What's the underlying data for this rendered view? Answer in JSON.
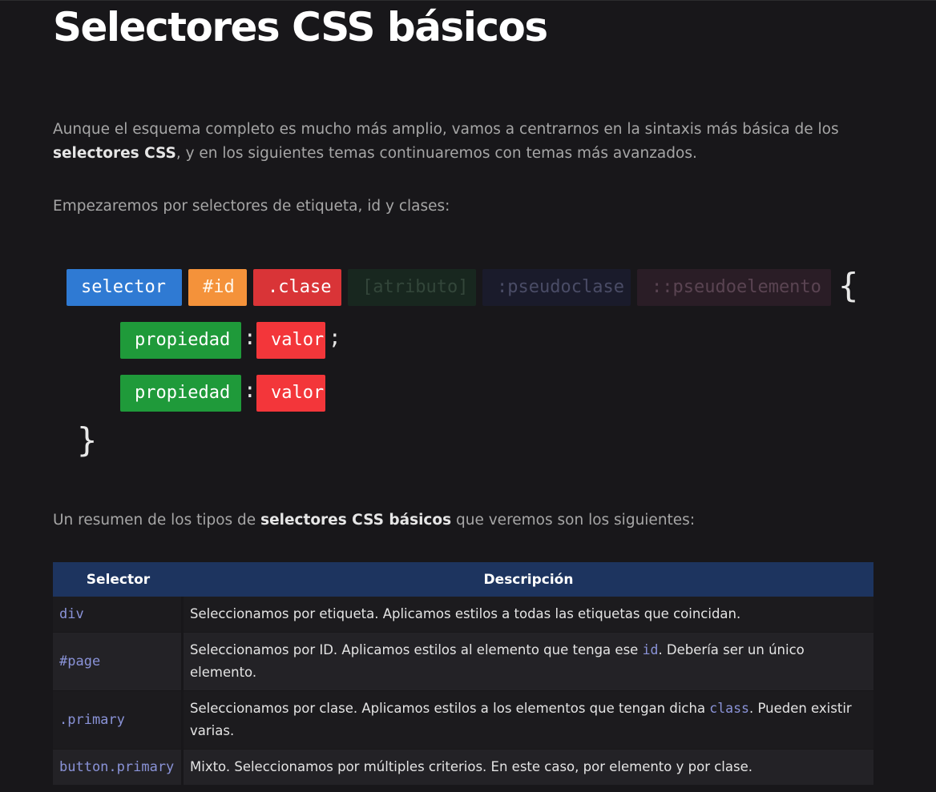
{
  "title": "Selectores CSS básicos",
  "intro": {
    "part1": "Aunque el esquema completo es mucho más amplio, vamos a centrarnos en la sintaxis más básica de los ",
    "bold": "selectores CSS",
    "part2": ", y en los siguientes temas continuaremos con temas más avanzados."
  },
  "lead": "Empezaremos por selectores de etiqueta, id y clases:",
  "diagram": {
    "selector": "selector",
    "id": "#id",
    "clase": ".clase",
    "atributo": "[atributo]",
    "pseudoclase": ":pseudoclase",
    "pseudoelemento": "::pseudoelemento",
    "open_brace": "{",
    "close_brace": "}",
    "colon": ":",
    "semicolon": ";",
    "property": "propiedad",
    "value": "valor",
    "colors": {
      "selector": "#2f7ad3",
      "id": "#f4923a",
      "clase": "#d93437",
      "property": "#1f9a3a",
      "value": "#f3363a"
    }
  },
  "summary": {
    "part1": "Un resumen de los tipos de ",
    "bold": "selectores CSS básicos",
    "part2": " que veremos son los siguientes:"
  },
  "table": {
    "headers": [
      "Selector",
      "Descripción"
    ],
    "rows": [
      {
        "selector": "div",
        "desc_pre": "Seleccionamos por etiqueta. Aplicamos estilos a todas las etiquetas que coincidan.",
        "code": "",
        "desc_post": ""
      },
      {
        "selector": "#page",
        "desc_pre": "Seleccionamos por ID. Aplicamos estilos al elemento que tenga ese ",
        "code": "id",
        "desc_post": ". Debería ser un único elemento."
      },
      {
        "selector": ".primary",
        "desc_pre": "Seleccionamos por clase. Aplicamos estilos a los elementos que tengan dicha ",
        "code": "class",
        "desc_post": ". Pueden existir varias."
      },
      {
        "selector": "button.primary",
        "desc_pre": "Mixto. Seleccionamos por múltiples criterios. En este caso, por elemento y por clase.",
        "code": "",
        "desc_post": ""
      }
    ]
  }
}
